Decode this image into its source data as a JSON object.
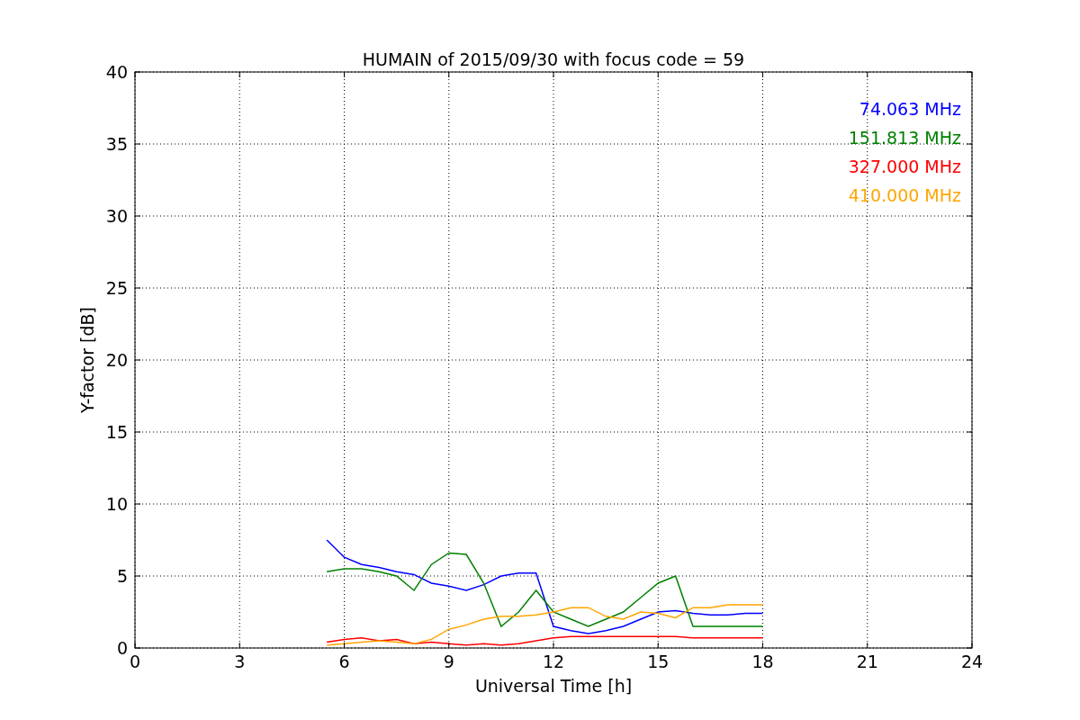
{
  "chart_data": {
    "type": "line",
    "title": "HUMAIN of 2015/09/30 with focus code = 59",
    "xlabel": "Universal Time [h]",
    "ylabel": "Y-factor [dB]",
    "x": [
      5.5,
      6,
      6.5,
      7,
      7.5,
      8,
      8.5,
      9,
      9.5,
      10,
      10.5,
      11,
      11.5,
      12,
      12.5,
      13,
      13.5,
      14,
      14.5,
      15,
      15.5,
      16,
      16.5,
      17,
      17.5,
      18
    ],
    "series": [
      {
        "name": "74.063 MHz",
        "color": "#0000ff",
        "values": [
          7.5,
          6.3,
          5.8,
          5.6,
          5.3,
          5.1,
          4.5,
          4.3,
          4.0,
          4.4,
          5.0,
          5.2,
          5.2,
          1.5,
          1.2,
          1.0,
          1.2,
          1.5,
          2.0,
          2.5,
          2.6,
          2.4,
          2.3,
          2.3,
          2.4,
          2.4
        ]
      },
      {
        "name": "151.813 MHz",
        "color": "#008000",
        "values": [
          5.3,
          5.5,
          5.5,
          5.3,
          5.0,
          4.0,
          5.8,
          6.6,
          6.5,
          4.5,
          1.5,
          2.5,
          4.0,
          2.5,
          2.0,
          1.5,
          2.0,
          2.5,
          3.5,
          4.5,
          5.0,
          1.5,
          1.5,
          1.5,
          1.5,
          1.5
        ]
      },
      {
        "name": "327.000 MHz",
        "color": "#ff0000",
        "values": [
          0.4,
          0.6,
          0.7,
          0.5,
          0.6,
          0.3,
          0.4,
          0.3,
          0.2,
          0.3,
          0.2,
          0.3,
          0.5,
          0.7,
          0.8,
          0.8,
          0.8,
          0.8,
          0.8,
          0.8,
          0.8,
          0.7,
          0.7,
          0.7,
          0.7,
          0.7
        ]
      },
      {
        "name": "410.000 MHz",
        "color": "#ffa500",
        "values": [
          0.2,
          0.3,
          0.4,
          0.5,
          0.4,
          0.3,
          0.6,
          1.3,
          1.6,
          2.0,
          2.2,
          2.2,
          2.3,
          2.5,
          2.8,
          2.8,
          2.2,
          2.0,
          2.5,
          2.4,
          2.1,
          2.8,
          2.8,
          3.0,
          3.0,
          3.0
        ]
      }
    ],
    "xlim": [
      0,
      24
    ],
    "ylim": [
      0,
      40
    ],
    "xticks": [
      0,
      3,
      6,
      9,
      12,
      15,
      18,
      21,
      24
    ],
    "yticks": [
      0,
      5,
      10,
      15,
      20,
      25,
      30,
      35,
      40
    ],
    "grid": true
  }
}
